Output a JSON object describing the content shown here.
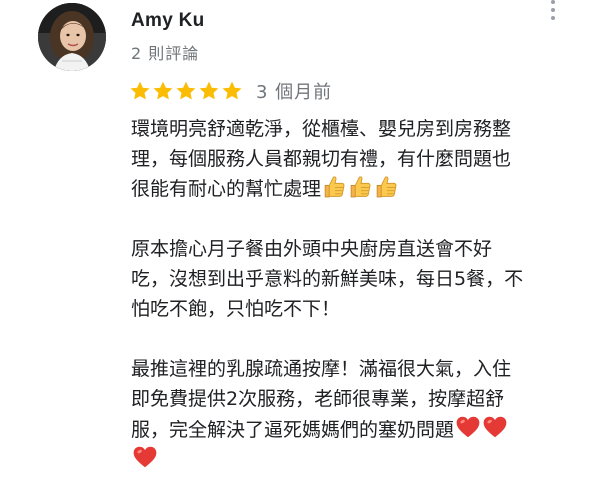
{
  "reviewer": {
    "name": "Amy Ku",
    "review_count": "2 則評論",
    "avatar_icon": "profile-photo"
  },
  "review": {
    "rating": 5,
    "rating_max": 5,
    "star_color": "#fbbc04",
    "time": "3 個月前",
    "paragraphs": [
      {
        "lines": [
          "環境明亮舒適乾淨，從櫃檯、嬰兒房到房務整",
          "理，每個服務人員都親切有禮，有什麼問題也",
          "很能有耐心的幫忙處理"
        ],
        "trailing_emoji": "thumbs-up-icon",
        "trailing_emoji_count": 3
      },
      {
        "lines": [
          "原本擔心月子餐由外頭中央廚房直送會不好",
          "吃，沒想到出乎意料的新鮮美味，每日5餐，不",
          "怕吃不飽，只怕吃不下！"
        ]
      },
      {
        "lines": [
          "最推這裡的乳腺疏通按摩！滿福很大氣，入住",
          "即免費提供2次服務，老師很專業，按摩超舒",
          "服，完全解決了逼死媽媽們的塞奶問題"
        ],
        "trailing_emoji": "red-heart-icon",
        "trailing_emoji_count": 3
      }
    ]
  },
  "more_options_icon": "more-vert-icon"
}
